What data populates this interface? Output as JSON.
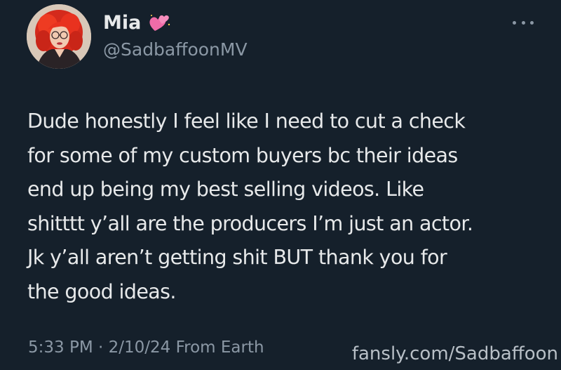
{
  "author": {
    "display_name": "Mia",
    "handle": "@SadbaffoonMV",
    "name_emoji": "sparkling-heart-icon"
  },
  "tweet": {
    "lines": [
      "Dude honestly I feel like I need to cut a check",
      "for some of my custom buyers bc their ideas",
      "end up being my best selling videos. Like",
      "shitttt y’all are the producers I’m just an actor.",
      "Jk y’all aren’t getting shit BUT thank you for",
      "the good ideas."
    ],
    "timestamp": "5:33 PM · 2/10/24 From Earth"
  },
  "watermark": "fansly.com/Sadbaffoon",
  "colors": {
    "background": "#15202b",
    "text": "#e7e9ea",
    "secondary_text": "#8b98a5",
    "avatar_hair": "#e8321f"
  },
  "icons": {
    "more": "more-horizontal-icon"
  }
}
